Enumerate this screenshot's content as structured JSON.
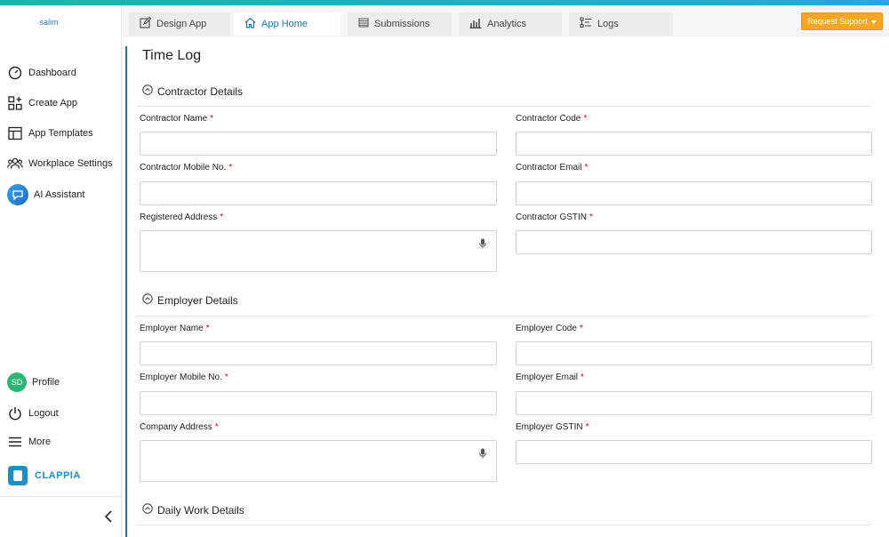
{
  "sidebar": {
    "workspace": "salim",
    "items": [
      {
        "label": "Dashboard",
        "icon": "dashboard-gauge-icon"
      },
      {
        "label": "Create App",
        "icon": "create-app-grid-icon"
      },
      {
        "label": "App Templates",
        "icon": "templates-layout-icon"
      },
      {
        "label": "Workplace Settings",
        "icon": "users-group-icon"
      },
      {
        "label": "AI Assistant",
        "icon": "ai-assistant-icon"
      }
    ],
    "bottom": [
      {
        "label": "Profile",
        "avatar": "SD"
      },
      {
        "label": "Logout",
        "icon": "power-icon"
      },
      {
        "label": "More",
        "icon": "menu-icon"
      }
    ],
    "brand": "CLAPPIA"
  },
  "tabs": [
    {
      "label": "Design App",
      "icon": "edit-icon"
    },
    {
      "label": "App Home",
      "icon": "home-icon",
      "active": true
    },
    {
      "label": "Submissions",
      "icon": "table-icon"
    },
    {
      "label": "Analytics",
      "icon": "bar-chart-icon"
    },
    {
      "label": "Logs",
      "icon": "logs-icon"
    }
  ],
  "support_button": "Request Support",
  "page_title": "Time Log",
  "sections": [
    {
      "title": "Contractor Details",
      "fields": {
        "name": "Contractor Name",
        "code": "Contractor Code",
        "mobile": "Contractor Mobile No.",
        "email": "Contractor Email",
        "address": "Registered Address",
        "gstin": "Contractor GSTIN"
      }
    },
    {
      "title": "Employer Details",
      "fields": {
        "name": "Employer Name",
        "code": "Employer Code",
        "mobile": "Employer Mobile No.",
        "email": "Employer Email",
        "address": "Company Address",
        "gstin": "Employer GSTIN"
      }
    },
    {
      "title": "Daily Work Details"
    }
  ],
  "required_marker": "*",
  "colors": {
    "accent": "#1e74b0",
    "support": "#f5a623",
    "required": "#d0021b",
    "brand": "#1e8fc6"
  }
}
